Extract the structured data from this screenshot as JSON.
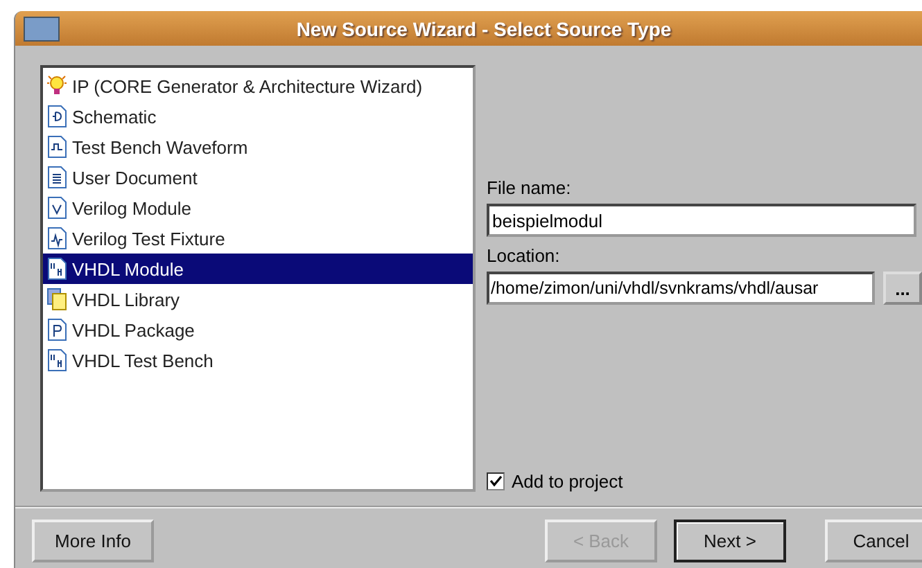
{
  "window": {
    "title": "New Source Wizard - Select Source Type"
  },
  "source_types": [
    {
      "label": "IP (CORE Generator & Architecture Wizard)",
      "kind": "bulb",
      "selected": false
    },
    {
      "label": "Schematic",
      "kind": "schematic",
      "selected": false
    },
    {
      "label": "Test Bench Waveform",
      "kind": "waveform",
      "selected": false
    },
    {
      "label": "User Document",
      "kind": "document",
      "selected": false
    },
    {
      "label": "Verilog Module",
      "kind": "verilog",
      "selected": false
    },
    {
      "label": "Verilog Test Fixture",
      "kind": "fixture",
      "selected": false
    },
    {
      "label": "VHDL Module",
      "kind": "vhdl",
      "selected": true
    },
    {
      "label": "VHDL Library",
      "kind": "library",
      "selected": false
    },
    {
      "label": "VHDL Package",
      "kind": "package",
      "selected": false
    },
    {
      "label": "VHDL Test Bench",
      "kind": "vhdl",
      "selected": false
    }
  ],
  "file_name": {
    "label": "File name:",
    "value": "beispielmodul"
  },
  "location": {
    "label": "Location:",
    "value": "/home/zimon/uni/vhdl/svnkrams/vhdl/ausar",
    "browse": "..."
  },
  "add_to_project": {
    "label": "Add to project",
    "checked": true
  },
  "buttons": [
    {
      "label": "More Info",
      "disabled": false,
      "default": false
    },
    {
      "label": "< Back",
      "disabled": true,
      "default": false
    },
    {
      "label": "Next >",
      "disabled": false,
      "default": true
    },
    {
      "label": "Cancel",
      "disabled": false,
      "default": false
    }
  ]
}
